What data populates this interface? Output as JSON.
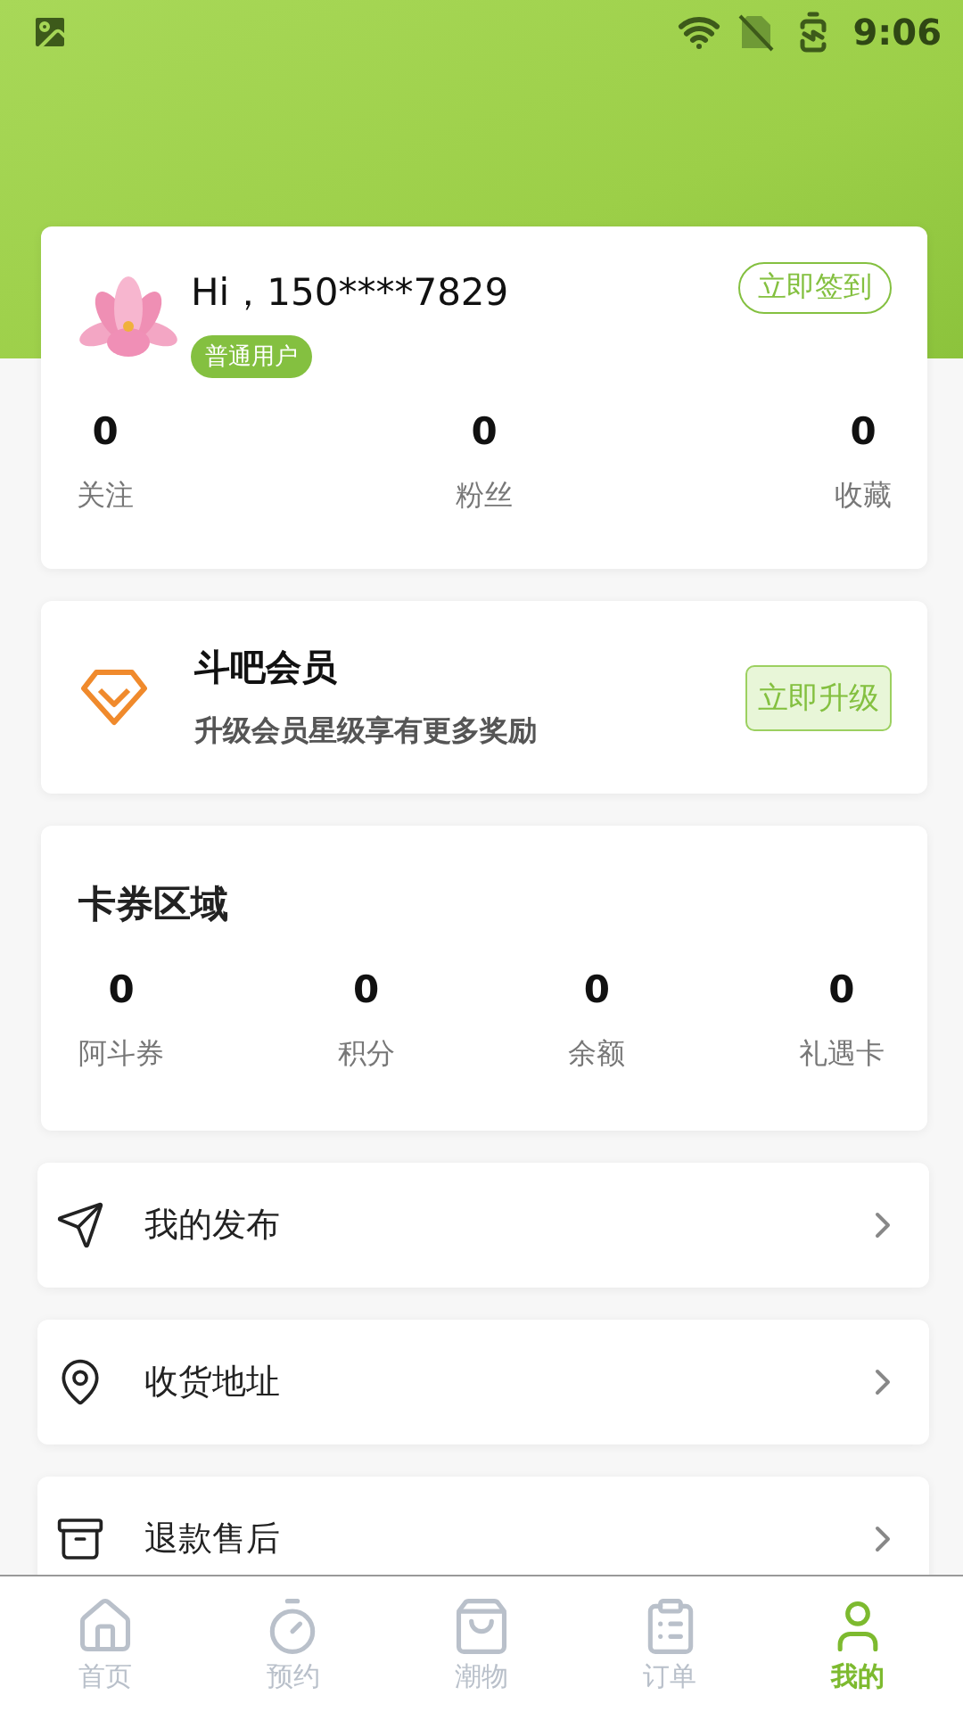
{
  "status_bar": {
    "time": "9:06"
  },
  "profile": {
    "greeting": "Hi，150****7829",
    "badge": "普通用户",
    "checkin_button": "立即签到",
    "stats": [
      {
        "value": "0",
        "label": "关注"
      },
      {
        "value": "0",
        "label": "粉丝"
      },
      {
        "value": "0",
        "label": "收藏"
      }
    ]
  },
  "membership": {
    "title": "斗吧会员",
    "subtitle": "升级会员星级享有更多奖励",
    "button": "立即升级"
  },
  "coupons": {
    "title": "卡券区域",
    "stats": [
      {
        "value": "0",
        "label": "阿斗券"
      },
      {
        "value": "0",
        "label": "积分"
      },
      {
        "value": "0",
        "label": "余额"
      },
      {
        "value": "0",
        "label": "礼遇卡"
      }
    ]
  },
  "menu": [
    {
      "kind": "send",
      "label": "我的发布"
    },
    {
      "kind": "location",
      "label": "收货地址"
    },
    {
      "kind": "archive",
      "label": "退款售后"
    }
  ],
  "tabs": [
    {
      "kind": "home",
      "label": "首页",
      "selected": false
    },
    {
      "kind": "timer",
      "label": "预约",
      "selected": false
    },
    {
      "kind": "bag",
      "label": "潮物",
      "selected": false
    },
    {
      "kind": "clipboard",
      "label": "订单",
      "selected": false
    },
    {
      "kind": "user",
      "label": "我的",
      "selected": true
    }
  ]
}
